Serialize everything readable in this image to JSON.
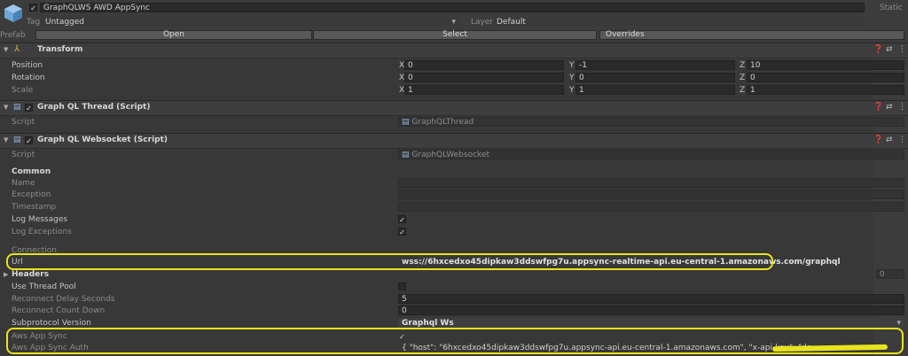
{
  "header": {
    "object_name": "GraphQLWS AWD AppSync",
    "static_label": "Static",
    "tag_label": "Tag",
    "tag_value": "Untagged",
    "layer_label": "Layer",
    "layer_value": "Default",
    "prefab_label": "Prefab",
    "open_label": "Open",
    "select_label": "Select",
    "overrides_label": "Overrides"
  },
  "transform": {
    "title": "Transform",
    "rows": [
      {
        "label": "Position",
        "x": "0",
        "y": "-1",
        "z": "10"
      },
      {
        "label": "Rotation",
        "x": "0",
        "y": "0",
        "z": "0"
      },
      {
        "label": "Scale",
        "x": "1",
        "y": "1",
        "z": "1"
      }
    ],
    "x_label": "X",
    "y_label": "Y",
    "z_label": "Z"
  },
  "thread": {
    "title": "Graph QL Thread (Script)",
    "script_label": "Script",
    "script_value": "GraphQLThread"
  },
  "websocket": {
    "title": "Graph QL Websocket (Script)",
    "script_label": "Script",
    "script_value": "GraphQLWebsocket",
    "common_label": "Common",
    "name_label": "Name",
    "exception_label": "Exception",
    "timestamp_label": "Timestamp",
    "log_messages_label": "Log Messages",
    "log_exceptions_label": "Log Exceptions",
    "connection_label": "Connection",
    "url_label": "Url",
    "url_value": "wss://6hxcedxo45dipkaw3ddswfpg7u.appsync-realtime-api.eu-central-1.amazonaws.com/graphql",
    "headers_label": "Headers",
    "headers_count": "0",
    "use_thread_pool_label": "Use Thread Pool",
    "reconnect_delay_label": "Reconnect Delay Seconds",
    "reconnect_delay_value": "5",
    "reconnect_count_label": "Reconnect Count Down",
    "reconnect_count_value": "0",
    "subprotocol_label": "Subprotocol Version",
    "subprotocol_value": "Graphql Ws",
    "aws_app_sync_label": "Aws App Sync",
    "aws_app_sync_auth_label": "Aws App Sync Auth",
    "aws_app_sync_auth_value": "{ \"host\": \"6hxcedxo45dipkaw3ddswfpg7u.appsync-api.eu-central-1.amazonaws.com\",  \"x-api-key\": \"da"
  },
  "colors": {
    "highlight": "#e9e31d"
  }
}
